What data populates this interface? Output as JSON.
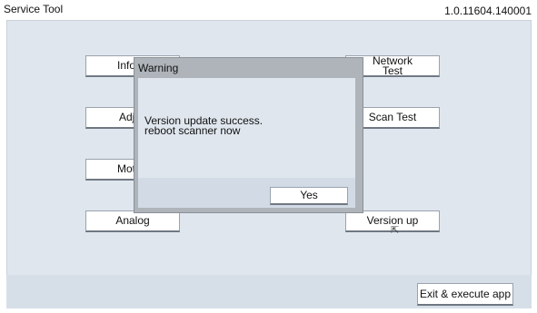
{
  "window": {
    "title": "Service Tool",
    "version": "1.0.11604.140001"
  },
  "buttons": {
    "information": "Inform",
    "adjust": "Adjus",
    "motor": "Motor/",
    "analog": "Analog",
    "network_test": "Network\nTest",
    "scan_test": "Scan Test",
    "version_up": "Version up",
    "exit": "Exit & execute app"
  },
  "dialog": {
    "title": "Warning",
    "message_line1": "Version update success.",
    "message_line2": "reboot scanner now",
    "yes_label": "Yes"
  },
  "icons": {
    "cursor": "mouse-pointer-icon"
  },
  "colors": {
    "workspace_bg": "#dfe6ee",
    "overlay_border": "#aeb4ba"
  }
}
